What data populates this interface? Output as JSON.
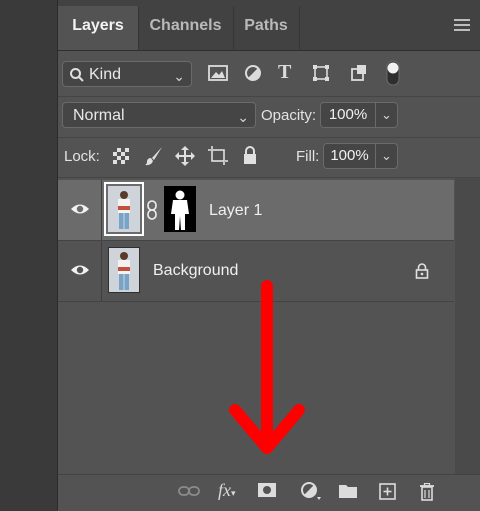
{
  "tabs": [
    {
      "label": "Layers",
      "active": true
    },
    {
      "label": "Channels",
      "active": false
    },
    {
      "label": "Paths",
      "active": false
    }
  ],
  "filter": {
    "kind_label": "Kind"
  },
  "blend": {
    "mode": "Normal",
    "opacity_label": "Opacity:",
    "opacity_value": "100%"
  },
  "lock": {
    "label": "Lock:",
    "fill_label": "Fill:",
    "fill_value": "100%"
  },
  "layers": [
    {
      "name": "Layer 1",
      "selected": true,
      "has_mask": true
    },
    {
      "name": "Background",
      "selected": false,
      "locked": true
    }
  ],
  "colors": {
    "panel": "#535353",
    "selected_row": "#6b6b6b",
    "arrow": "#ff0000"
  }
}
